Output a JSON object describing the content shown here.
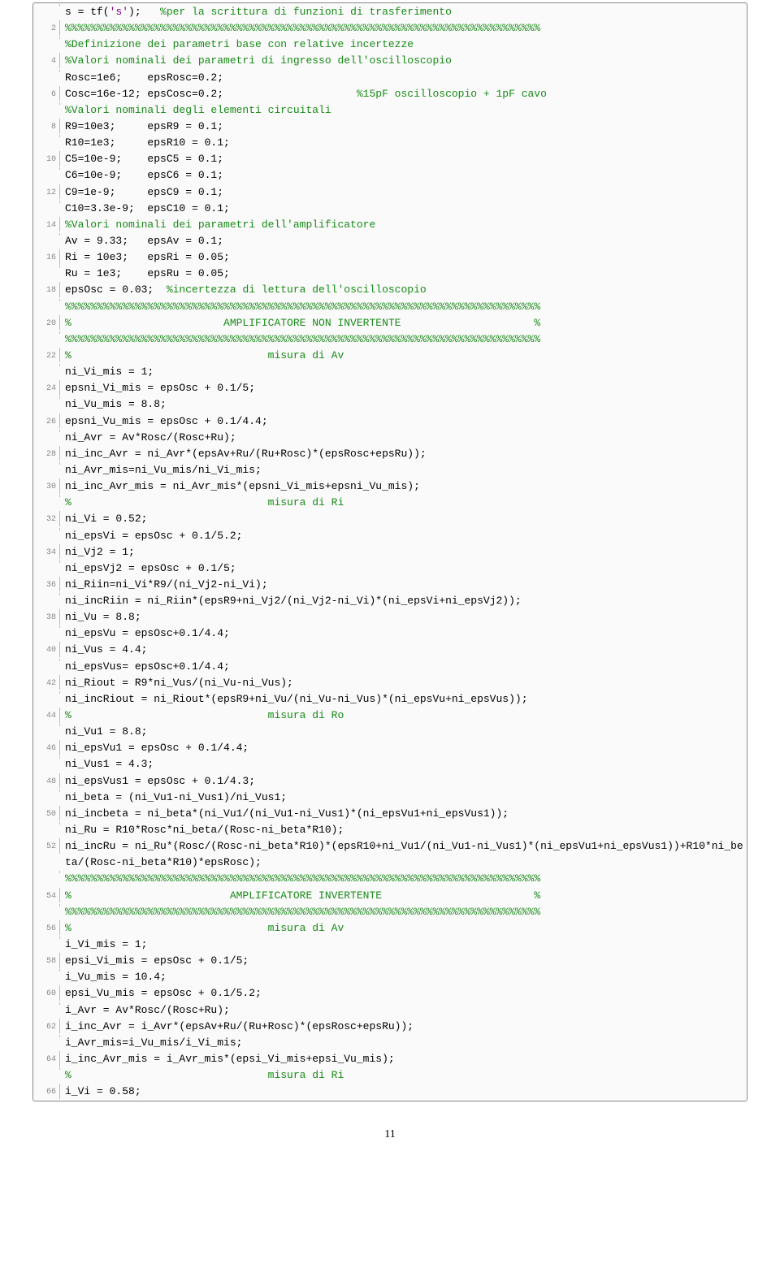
{
  "page_number": "11",
  "lines": [
    {
      "n": "",
      "tokens": [
        [
          "blk",
          "s = tf("
        ],
        [
          "str",
          "'s'"
        ],
        [
          "blk",
          ");   "
        ],
        [
          "cm",
          "%per la scrittura di funzioni di trasferimento"
        ]
      ]
    },
    {
      "n": "2",
      "tokens": [
        [
          "cm",
          "%%%%%%%%%%%%%%%%%%%%%%%%%%%%%%%%%%%%%%%%%%%%%%%%%%%%%%%%%%%%%%%%%%%%%%%%%%%"
        ]
      ]
    },
    {
      "n": "",
      "tokens": [
        [
          "cm",
          "%Definizione dei parametri base con relative incertezze"
        ]
      ]
    },
    {
      "n": "4",
      "tokens": [
        [
          "cm",
          "%Valori nominali dei parametri di ingresso dell'oscilloscopio"
        ]
      ]
    },
    {
      "n": "",
      "tokens": [
        [
          "blk",
          "Rosc=1e6;    epsRosc=0.2;"
        ]
      ]
    },
    {
      "n": "6",
      "tokens": [
        [
          "blk",
          "Cosc=16e-12; epsCosc=0.2;                     "
        ],
        [
          "cm",
          "%15pF oscilloscopio + 1pF cavo"
        ]
      ]
    },
    {
      "n": "",
      "tokens": [
        [
          "cm",
          "%Valori nominali degli elementi circuitali"
        ]
      ]
    },
    {
      "n": "8",
      "tokens": [
        [
          "blk",
          "R9=10e3;     epsR9 = 0.1;"
        ]
      ]
    },
    {
      "n": "",
      "tokens": [
        [
          "blk",
          "R10=1e3;     epsR10 = 0.1;"
        ]
      ]
    },
    {
      "n": "10",
      "tokens": [
        [
          "blk",
          "C5=10e-9;    epsC5 = 0.1;"
        ]
      ]
    },
    {
      "n": "",
      "tokens": [
        [
          "blk",
          "C6=10e-9;    epsC6 = 0.1;"
        ]
      ]
    },
    {
      "n": "12",
      "tokens": [
        [
          "blk",
          "C9=1e-9;     epsC9 = 0.1;"
        ]
      ]
    },
    {
      "n": "",
      "tokens": [
        [
          "blk",
          "C10=3.3e-9;  epsC10 = 0.1;"
        ]
      ]
    },
    {
      "n": "14",
      "tokens": [
        [
          "cm",
          "%Valori nominali dei parametri dell'amplificatore"
        ]
      ]
    },
    {
      "n": "",
      "tokens": [
        [
          "blk",
          "Av = 9.33;   epsAv = 0.1;"
        ]
      ]
    },
    {
      "n": "16",
      "tokens": [
        [
          "blk",
          "Ri = 10e3;   epsRi = 0.05;"
        ]
      ]
    },
    {
      "n": "",
      "tokens": [
        [
          "blk",
          "Ru = 1e3;    epsRu = 0.05;"
        ]
      ]
    },
    {
      "n": "18",
      "tokens": [
        [
          "blk",
          "epsOsc = 0.03;  "
        ],
        [
          "cm",
          "%incertezza di lettura dell'oscilloscopio"
        ]
      ]
    },
    {
      "n": "",
      "tokens": [
        [
          "cm",
          "%%%%%%%%%%%%%%%%%%%%%%%%%%%%%%%%%%%%%%%%%%%%%%%%%%%%%%%%%%%%%%%%%%%%%%%%%%%"
        ]
      ]
    },
    {
      "n": "20",
      "tokens": [
        [
          "cm",
          "%                        AMPLIFICATORE NON INVERTENTE                     %"
        ]
      ]
    },
    {
      "n": "",
      "tokens": [
        [
          "cm",
          "%%%%%%%%%%%%%%%%%%%%%%%%%%%%%%%%%%%%%%%%%%%%%%%%%%%%%%%%%%%%%%%%%%%%%%%%%%%"
        ]
      ]
    },
    {
      "n": "22",
      "tokens": [
        [
          "cm",
          "%                               misura di Av"
        ]
      ]
    },
    {
      "n": "",
      "tokens": [
        [
          "blk",
          "ni_Vi_mis = 1;"
        ]
      ]
    },
    {
      "n": "24",
      "tokens": [
        [
          "blk",
          "epsni_Vi_mis = epsOsc + 0.1/5;"
        ]
      ]
    },
    {
      "n": "",
      "tokens": [
        [
          "blk",
          "ni_Vu_mis = 8.8;"
        ]
      ]
    },
    {
      "n": "26",
      "tokens": [
        [
          "blk",
          "epsni_Vu_mis = epsOsc + 0.1/4.4;"
        ]
      ]
    },
    {
      "n": "",
      "tokens": [
        [
          "blk",
          "ni_Avr = Av*Rosc/(Rosc+Ru);"
        ]
      ]
    },
    {
      "n": "28",
      "tokens": [
        [
          "blk",
          "ni_inc_Avr = ni_Avr*(epsAv+Ru/(Ru+Rosc)*(epsRosc+epsRu));"
        ]
      ]
    },
    {
      "n": "",
      "tokens": [
        [
          "blk",
          "ni_Avr_mis=ni_Vu_mis/ni_Vi_mis;"
        ]
      ]
    },
    {
      "n": "30",
      "tokens": [
        [
          "blk",
          "ni_inc_Avr_mis = ni_Avr_mis*(epsni_Vi_mis+epsni_Vu_mis);"
        ]
      ]
    },
    {
      "n": "",
      "tokens": [
        [
          "cm",
          "%                               misura di Ri"
        ]
      ]
    },
    {
      "n": "32",
      "tokens": [
        [
          "blk",
          "ni_Vi = 0.52;"
        ]
      ]
    },
    {
      "n": "",
      "tokens": [
        [
          "blk",
          "ni_epsVi = epsOsc + 0.1/5.2;"
        ]
      ]
    },
    {
      "n": "34",
      "tokens": [
        [
          "blk",
          "ni_Vj2 = 1;"
        ]
      ]
    },
    {
      "n": "",
      "tokens": [
        [
          "blk",
          "ni_epsVj2 = epsOsc + 0.1/5;"
        ]
      ]
    },
    {
      "n": "36",
      "tokens": [
        [
          "blk",
          "ni_Riin=ni_Vi*R9/(ni_Vj2-ni_Vi);"
        ]
      ]
    },
    {
      "n": "",
      "tokens": [
        [
          "blk",
          "ni_incRiin = ni_Riin*(epsR9+ni_Vj2/(ni_Vj2-ni_Vi)*(ni_epsVi+ni_epsVj2));"
        ]
      ]
    },
    {
      "n": "38",
      "tokens": [
        [
          "blk",
          "ni_Vu = 8.8;"
        ]
      ]
    },
    {
      "n": "",
      "tokens": [
        [
          "blk",
          "ni_epsVu = epsOsc+0.1/4.4;"
        ]
      ]
    },
    {
      "n": "40",
      "tokens": [
        [
          "blk",
          "ni_Vus = 4.4;"
        ]
      ]
    },
    {
      "n": "",
      "tokens": [
        [
          "blk",
          "ni_epsVus= epsOsc+0.1/4.4;"
        ]
      ]
    },
    {
      "n": "42",
      "tokens": [
        [
          "blk",
          "ni_Riout = R9*ni_Vus/(ni_Vu-ni_Vus);"
        ]
      ]
    },
    {
      "n": "",
      "tokens": [
        [
          "blk",
          "ni_incRiout = ni_Riout*(epsR9+ni_Vu/(ni_Vu-ni_Vus)*(ni_epsVu+ni_epsVus));"
        ]
      ]
    },
    {
      "n": "44",
      "tokens": [
        [
          "cm",
          "%                               misura di Ro"
        ]
      ]
    },
    {
      "n": "",
      "tokens": [
        [
          "blk",
          "ni_Vu1 = 8.8;"
        ]
      ]
    },
    {
      "n": "46",
      "tokens": [
        [
          "blk",
          "ni_epsVu1 = epsOsc + 0.1/4.4;"
        ]
      ]
    },
    {
      "n": "",
      "tokens": [
        [
          "blk",
          "ni_Vus1 = 4.3;"
        ]
      ]
    },
    {
      "n": "48",
      "tokens": [
        [
          "blk",
          "ni_epsVus1 = epsOsc + 0.1/4.3;"
        ]
      ]
    },
    {
      "n": "",
      "tokens": [
        [
          "blk",
          "ni_beta = (ni_Vu1-ni_Vus1)/ni_Vus1;"
        ]
      ]
    },
    {
      "n": "50",
      "tokens": [
        [
          "blk",
          "ni_incbeta = ni_beta*(ni_Vu1/(ni_Vu1-ni_Vus1)*(ni_epsVu1+ni_epsVus1));"
        ]
      ]
    },
    {
      "n": "",
      "tokens": [
        [
          "blk",
          "ni_Ru = R10*Rosc*ni_beta/(Rosc-ni_beta*R10);"
        ]
      ]
    },
    {
      "n": "52",
      "tokens": [
        [
          "blk",
          "ni_incRu = ni_Ru*(Rosc/(Rosc-ni_beta*R10)*(epsR10+ni_Vu1/(ni_Vu1-ni_Vus1)*(ni_epsVu1+ni_epsVus1))+R10*ni_beta/(Rosc-ni_beta*R10)*epsRosc);"
        ]
      ]
    },
    {
      "n": "",
      "tokens": [
        [
          "cm",
          "%%%%%%%%%%%%%%%%%%%%%%%%%%%%%%%%%%%%%%%%%%%%%%%%%%%%%%%%%%%%%%%%%%%%%%%%%%%"
        ]
      ]
    },
    {
      "n": "54",
      "tokens": [
        [
          "cm",
          "%                         AMPLIFICATORE INVERTENTE                        %"
        ]
      ]
    },
    {
      "n": "",
      "tokens": [
        [
          "cm",
          "%%%%%%%%%%%%%%%%%%%%%%%%%%%%%%%%%%%%%%%%%%%%%%%%%%%%%%%%%%%%%%%%%%%%%%%%%%%"
        ]
      ]
    },
    {
      "n": "56",
      "tokens": [
        [
          "cm",
          "%                               misura di Av"
        ]
      ]
    },
    {
      "n": "",
      "tokens": [
        [
          "blk",
          "i_Vi_mis = 1;"
        ]
      ]
    },
    {
      "n": "58",
      "tokens": [
        [
          "blk",
          "epsi_Vi_mis = epsOsc + 0.1/5;"
        ]
      ]
    },
    {
      "n": "",
      "tokens": [
        [
          "blk",
          "i_Vu_mis = 10.4;"
        ]
      ]
    },
    {
      "n": "60",
      "tokens": [
        [
          "blk",
          "epsi_Vu_mis = epsOsc + 0.1/5.2;"
        ]
      ]
    },
    {
      "n": "",
      "tokens": [
        [
          "blk",
          "i_Avr = Av*Rosc/(Rosc+Ru);"
        ]
      ]
    },
    {
      "n": "62",
      "tokens": [
        [
          "blk",
          "i_inc_Avr = i_Avr*(epsAv+Ru/(Ru+Rosc)*(epsRosc+epsRu));"
        ]
      ]
    },
    {
      "n": "",
      "tokens": [
        [
          "blk",
          "i_Avr_mis=i_Vu_mis/i_Vi_mis;"
        ]
      ]
    },
    {
      "n": "64",
      "tokens": [
        [
          "blk",
          "i_inc_Avr_mis = i_Avr_mis*(epsi_Vi_mis+epsi_Vu_mis);"
        ]
      ]
    },
    {
      "n": "",
      "tokens": [
        [
          "cm",
          "%                               misura di Ri"
        ]
      ]
    },
    {
      "n": "66",
      "tokens": [
        [
          "blk",
          "i_Vi = 0.58;"
        ]
      ]
    }
  ]
}
